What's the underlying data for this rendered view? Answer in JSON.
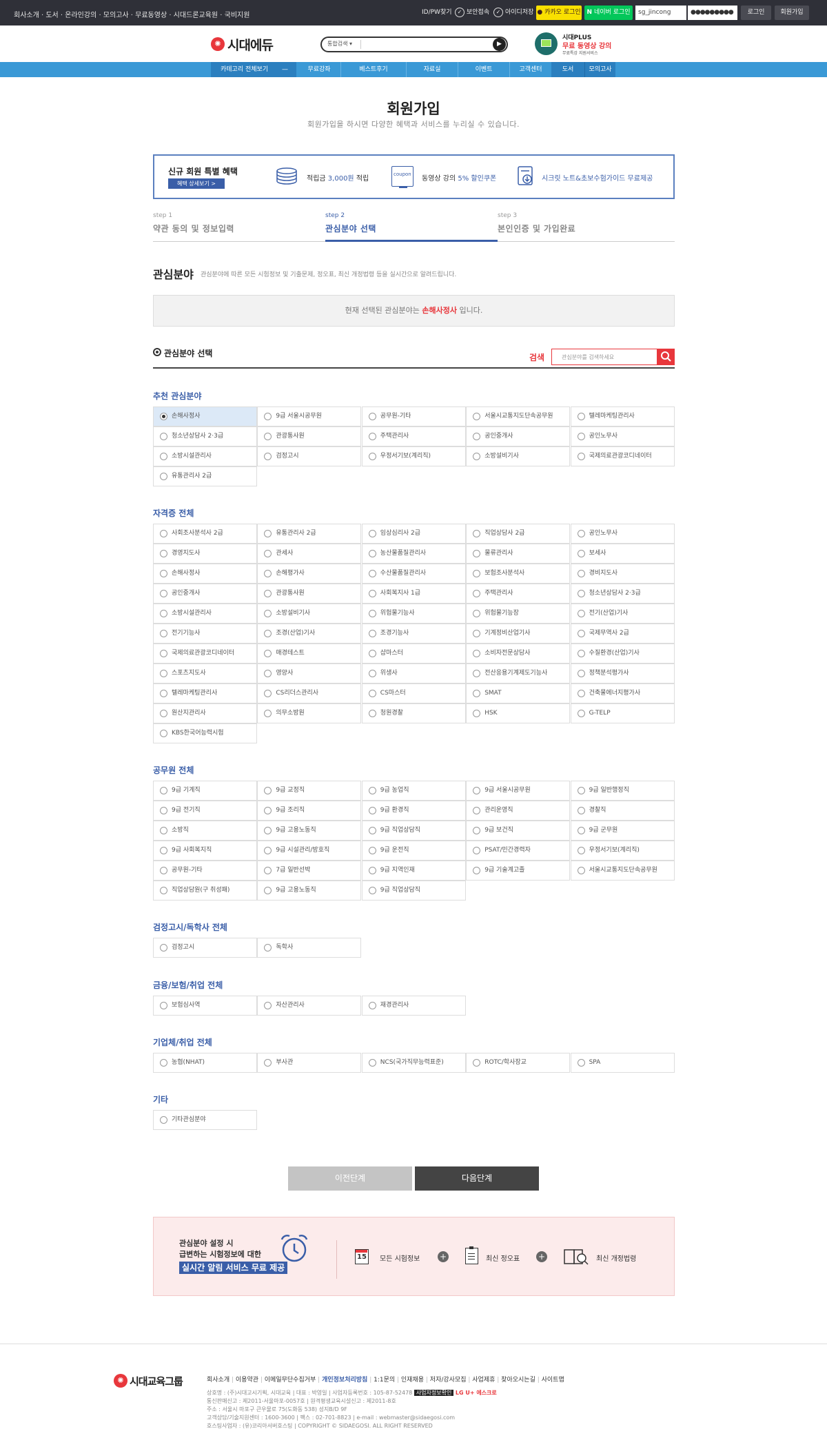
{
  "topbar": {
    "links": "회사소개 · 도서 · 온라인강의 · 모의고사 · 무료동영상 · 시대드론교육원 · 국비지원",
    "find": "ID/PW찾기",
    "secure": "보안접속",
    "save_id": "아이디저장",
    "kakao": "카카오 로그인",
    "naver": "네이버 로그인",
    "id_value": "sg_jincong",
    "pw_value": "●●●●●●●●●",
    "login": "로그인",
    "join": "회원가입"
  },
  "header": {
    "logo": "시대에듀",
    "search_scope": "통합검색",
    "plus_line1": "시대PLUS",
    "plus_line2": "무료 동영상 강의",
    "plus_line3": "무료특강 지원서비스"
  },
  "nav": [
    "카테고리 전체보기",
    "무료강좌",
    "베스트후기",
    "자료실",
    "이벤트",
    "고객센터",
    "도서",
    "모의고사"
  ],
  "page": {
    "title": "회원가입",
    "subtitle": "회원가입을 하시면 다양한 혜택과 서비스를 누리실 수 있습니다."
  },
  "benefit": {
    "title": "신규 회원 특별 혜택",
    "detail": "혜택 상세보기 >",
    "item1_pre": "적립금",
    "item1_em": "3,000원",
    "item1_post": "적립",
    "item2_icon": "coupon",
    "item2_pre": "동영상 강의",
    "item2_em": "5% 할인쿠폰",
    "item3": "시크릿 노트&초보수험가이드 무료제공"
  },
  "steps": [
    {
      "num": "step 1",
      "label": "약관 동의 및 정보입력"
    },
    {
      "num": "step 2",
      "label": "관심분야 선택"
    },
    {
      "num": "step 3",
      "label": "본인인증 및 가입완료"
    }
  ],
  "interest": {
    "title": "관심분야",
    "desc": "관심분야에 따른 모든 시험정보 및 기출문제, 정오표, 최신 개정법령 등을 실시간으로 알려드립니다.",
    "current_pre": "현재 선택된 관심분야는",
    "current_value": "손해사정사",
    "current_post": "입니다.",
    "select_label": "관심분야 선택",
    "search_label": "검색",
    "search_placeholder": "관심분야를 검색하세요"
  },
  "sections": [
    {
      "title": "추천 관심분야",
      "items": [
        "손해사정사",
        "9급 서울시공무원",
        "공무원-기타",
        "서울시교통지도단속공무원",
        "텔레마케팅관리사",
        "청소년상담사 2·3급",
        "관광통사원",
        "주택관리사",
        "공인중개사",
        "공인노무사",
        "소방시설관리사",
        "검정고시",
        "우정서기보(계리직)",
        "소방설비기사",
        "국제의료관광코디네이터",
        "유통관리사 2급"
      ]
    },
    {
      "title": "자격증 전체",
      "items": [
        "사회조사분석사 2급",
        "유통관리사 2급",
        "임상심리사 2급",
        "직업상담사 2급",
        "공인노무사",
        "경영지도사",
        "관세사",
        "농산물품질관리사",
        "물류관리사",
        "보세사",
        "손해사정사",
        "손해평가사",
        "수산물품질관리사",
        "보험조사분석사",
        "경비지도사",
        "공인중개사",
        "관광통사원",
        "사회복지사 1급",
        "주택관리사",
        "청소년상담사 2·3급",
        "소방시설관리사",
        "소방설비기사",
        "위험물기능사",
        "위험물기능장",
        "전기(산업)기사",
        "전기기능사",
        "조경(산업)기사",
        "조경기능사",
        "기계정비산업기사",
        "국제무역사 2급",
        "국제의료관광코디네이터",
        "매경테스트",
        "샵마스터",
        "소비자전문상담사",
        "수질환경(산업)기사",
        "스포츠지도사",
        "영양사",
        "위생사",
        "전산응용기계제도기능사",
        "정책분석평가사",
        "텔레마케팅관리사",
        "CS리더스관리사",
        "CS마스터",
        "SMAT",
        "건축물에너지평가사",
        "원산지관리사",
        "의무소방원",
        "청원경찰",
        "HSK",
        "G-TELP",
        "KBS한국어능력시험"
      ]
    },
    {
      "title": "공무원 전체",
      "items": [
        "9급 기계직",
        "9급 교정직",
        "9급 농업직",
        "9급 서울시공무원",
        "9급 일반행정직",
        "9급 전기직",
        "9급 조리직",
        "9급 환경직",
        "관리운영직",
        "경찰직",
        "소방직",
        "9급 고용노동직",
        "9급 직업상담직",
        "9급 보건직",
        "9급 군무원",
        "9급 사회복지직",
        "9급 시설관리/방호직",
        "9급 운전직",
        "PSAT/민간경력자",
        "우정서기보(계리직)",
        "공무원-기타",
        "7급 일반선박",
        "9급 지역인재",
        "9급 기술계고졸",
        "서울시교통지도단속공무원",
        "직업상담원(구 취성패)",
        "9급 고용노동직",
        "9급 직업상담직"
      ]
    },
    {
      "title": "검정고시/독학사 전체",
      "items": [
        "검정고시",
        "독학사"
      ]
    },
    {
      "title": "금융/보험/취업 전체",
      "items": [
        "보험심사역",
        "자산관리사",
        "재경관리사"
      ]
    },
    {
      "title": "기업체/취업 전체",
      "items": [
        "농협(NHAT)",
        "부사관",
        "NCS(국가직무능력표준)",
        "ROTC/학사장교",
        "SPA"
      ]
    },
    {
      "title": "기타",
      "items": [
        "기타관심분야"
      ]
    }
  ],
  "buttons": {
    "prev": "이전단계",
    "next": "다음단계"
  },
  "alert": {
    "line1": "관심분야 설정 시",
    "line2": "급변하는 시험정보에 대한",
    "line3": "실시간 알림 서비스 무료 제공",
    "cal_num": "15",
    "item1": "모든 시험정보",
    "item2": "최신 정오표",
    "item3": "최신 개정법령"
  },
  "footer": {
    "logo": "시대교육그룹",
    "links": [
      "회사소개",
      "이용약관",
      "이메일무단수집거부",
      "개인정보처리방침",
      "1:1문의",
      "인재채용",
      "저자/강사모집",
      "사업제휴",
      "찾아오시는길",
      "사이트맵"
    ],
    "info1": "상호명 : (주)시대고시기획, 시대교육 | 대표 : 박영일 | 사업자등록번호 : 105-87-52478",
    "badge": "사업자정보확인",
    "lgu": "LG U+ 에스크로",
    "info2": "통신판매신고 : 제2011-서울마포-0057호 | 원격평생교육시설신고 : 제2011-8호",
    "info3": "주소 : 서울시 마포구 큰우물로 75(도화동 538) 성지B/D 9F",
    "info4": "고객상담/기술지원센터 : 1600-3600 | 팩스 : 02-701-8823 | e-mail : webmaster@sidaegosi.com",
    "info5": "호스팅사업자 : (유)코리아서버호스팅 | COPYRIGHT © SIDAEGOSI. ALL RIGHT RESERVED"
  },
  "colors": {
    "accent": "#3a5ea8",
    "nav": "#3a99d6",
    "red": "#e8373c"
  }
}
